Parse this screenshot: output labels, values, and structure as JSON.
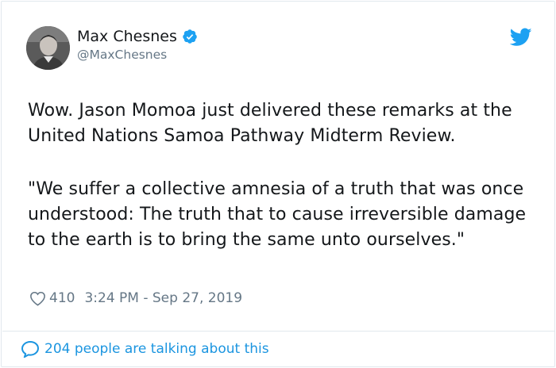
{
  "author": {
    "name": "Max Chesnes",
    "handle": "@MaxChesnes",
    "verified": true
  },
  "tweet": {
    "paragraphs": [
      "Wow. Jason Momoa just delivered these remarks at the United Nations Samoa Pathway Midterm Review.",
      "\"We suffer a collective amnesia of a truth that was once understood: The truth that to cause irreversible damage to the earth is to bring the same unto ourselves.\""
    ],
    "likes": "410",
    "timestamp": "3:24 PM - Sep 27, 2019"
  },
  "footer": {
    "talking_label": "204 people are talking about this"
  },
  "colors": {
    "accent": "#1da1f2",
    "link": "#1b95e0",
    "secondary_text": "#657786",
    "border": "#e1e8ed"
  },
  "icons": [
    "verified-badge-icon",
    "twitter-bird-icon",
    "heart-icon",
    "speech-bubble-icon"
  ]
}
